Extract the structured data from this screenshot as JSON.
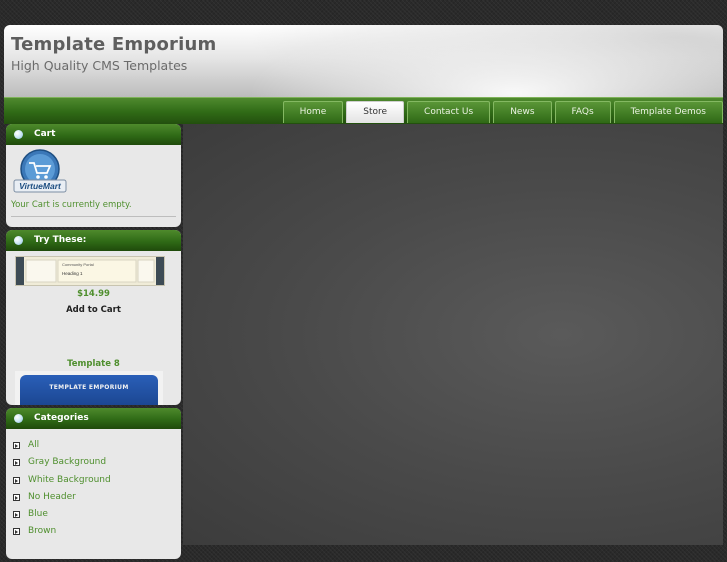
{
  "header": {
    "title": "Template Emporium",
    "slogan": "High Quality CMS Templates"
  },
  "nav": {
    "items": [
      "Home",
      "Store",
      "Contact Us",
      "News",
      "FAQs",
      "Template Demos"
    ],
    "active": "Store"
  },
  "cart": {
    "heading": "Cart",
    "logo_text": "VirtueMart",
    "empty_text": "Your Cart is currently empty."
  },
  "try_these": {
    "heading": "Try These:",
    "thumb1": {
      "caption": "Community Portal",
      "heading": "Heading 1"
    },
    "price": "$14.99",
    "add_to_cart": "Add to Cart",
    "template_name": "Template 8",
    "thumb2_title": "TEMPLATE EMPORIUM"
  },
  "categories": {
    "heading": "Categories",
    "items": [
      "All",
      "Gray Background",
      "White Background",
      "No Header",
      "Blue",
      "Brown"
    ]
  },
  "colors": {
    "accent_green": "#4f8f2e",
    "nav_green": "#2f6a16",
    "page_bg": "#2a2a2a",
    "content_bg": "#4a4a4a"
  }
}
